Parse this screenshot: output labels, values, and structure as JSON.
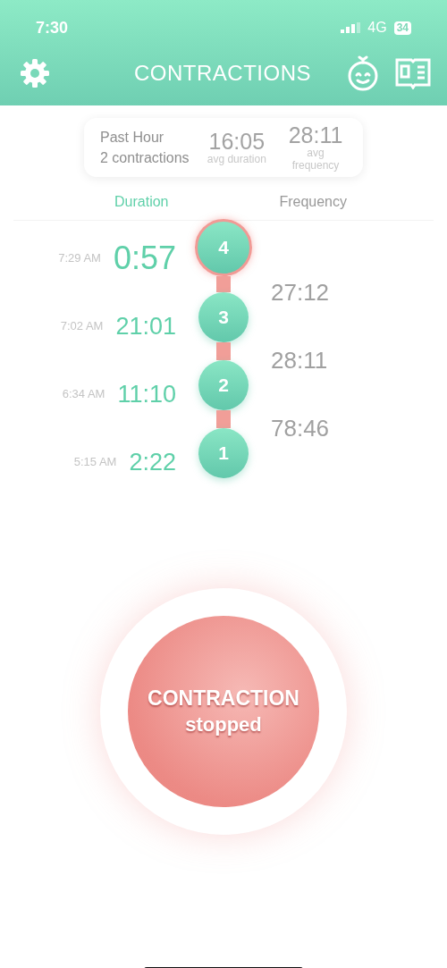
{
  "status_bar": {
    "time": "7:30",
    "network": "4G",
    "battery": "34"
  },
  "header": {
    "title": "CONTRACTIONS"
  },
  "summary": {
    "period": "Past Hour",
    "count": "2 contractions",
    "stats": [
      {
        "value": "16:05",
        "label": "avg duration"
      },
      {
        "value": "28:11",
        "label": "avg frequency"
      }
    ]
  },
  "tabs": [
    {
      "label": "Duration",
      "selected": true
    },
    {
      "label": "Frequency",
      "selected": false
    }
  ],
  "contractions": [
    {
      "number": "4",
      "time": "7:29 AM",
      "duration": "0:57",
      "frequency": "27:12",
      "selected": true
    },
    {
      "number": "3",
      "time": "7:02 AM",
      "duration": "21:01",
      "frequency": "28:11",
      "selected": false
    },
    {
      "number": "2",
      "time": "6:34 AM",
      "duration": "11:10",
      "frequency": "78:46",
      "selected": false
    },
    {
      "number": "1",
      "time": "5:15 AM",
      "duration": "2:22",
      "selected": false
    }
  ],
  "main_button": {
    "title": "CONTRACTION",
    "subtitle": "stopped"
  }
}
